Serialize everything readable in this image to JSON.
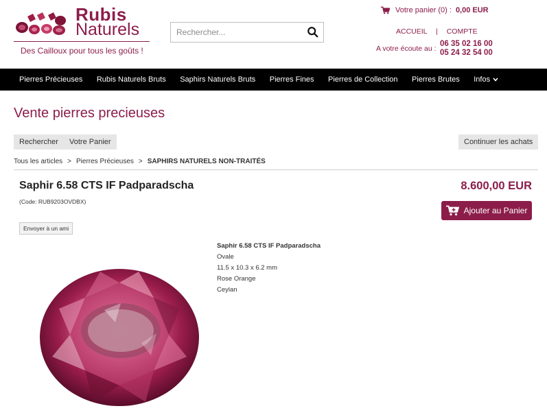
{
  "header": {
    "logo_line1": "Rubis",
    "logo_line2": "Naturels",
    "tagline": "Des Cailloux pour tous les goûts !",
    "search_placeholder": "Rechercher...",
    "cart_label": "Votre panier (0) :",
    "cart_amount": "0,00 EUR",
    "link_home": "ACCUEIL",
    "link_separator": "|",
    "link_account": "COMPTE",
    "contact_label": "A votre écoute au :",
    "phone1": "06 35 02 16 00",
    "phone2": "05 24 32 54 00"
  },
  "nav": {
    "items": [
      "Pierres Précieuses",
      "Rubis Naturels Bruts",
      "Saphirs Naturels Bruts",
      "Pierres Fines",
      "Pierres de Collection",
      "Pierres Brutes",
      "Infos"
    ]
  },
  "page": {
    "title": "Vente pierres precieuses",
    "btn_search": "Rechercher",
    "btn_cart": "Votre Panier",
    "btn_continue": "Continuer les achats",
    "breadcrumb": [
      "Tous les articles",
      "Pierres Précieuses",
      "SAPHIRS NATURELS NON-TRAITÉS"
    ],
    "breadcrumb_sep": ">"
  },
  "product": {
    "title": "Saphir 6.58 CTS IF Padparadscha",
    "code": "(Code: RUB9203OVDBX)",
    "price": "8.600,00 EUR",
    "add_to_cart": "Ajouter au Panier",
    "send_friend": "Envoyer à un ami",
    "details": {
      "title": "Saphir 6.58 CTS IF Padparadscha",
      "shape": "Ovale",
      "dimensions": "11.5 x 10.3 x 6.2 mm",
      "color": "Rose Orange",
      "origin": "Ceylan"
    }
  },
  "colors": {
    "brand": "#8c1d4a",
    "nav_bg": "#000000",
    "button_grey": "#e6e6e6"
  },
  "icons": [
    "cart-icon",
    "search-icon",
    "chevron-down-icon",
    "cart-plus-icon",
    "gem-image"
  ]
}
